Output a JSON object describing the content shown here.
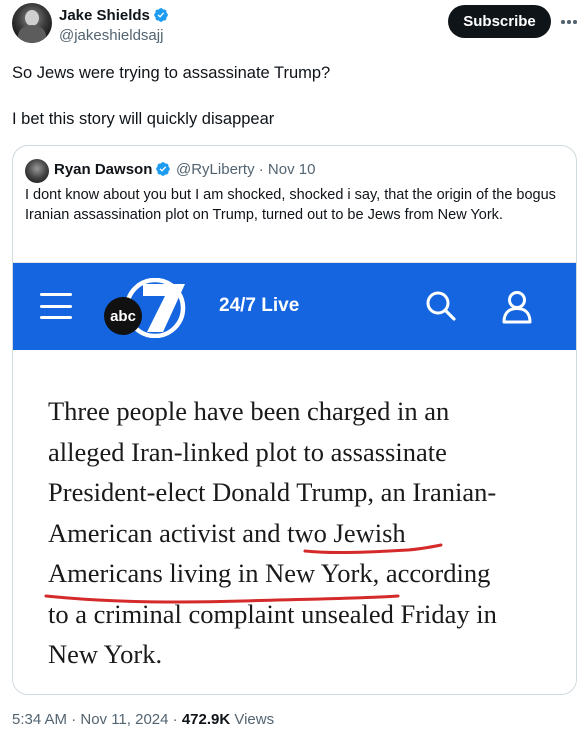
{
  "author": {
    "name": "Jake Shields",
    "handle": "@jakeshieldsajj",
    "subscribe_label": "Subscribe"
  },
  "tweet": {
    "line1": "So Jews were trying to assassinate Trump?",
    "line2": "I bet this story will quickly disappear"
  },
  "quote": {
    "name": "Ryan Dawson",
    "meta": "@RyLiberty · Nov 10",
    "text": "I dont know about you but I am shocked, shocked i say, that the origin of the bogus Iranian assassination plot on Trump, turned out to be Jews from New York.",
    "image": {
      "bar": {
        "live_label": "24/7 Live",
        "logo_text": "abc",
        "brand_color": "#1565e0"
      },
      "headline_lines": [
        "Three people have been charged in an",
        "alleged Iran-linked plot to assassinate",
        "President-elect Donald Trump, an Iranian-",
        "American activist and two Jewish",
        "Americans living in New York, according",
        "to a criminal complaint unsealed Friday in",
        "New York."
      ],
      "annotation_color": "#d42a2a"
    }
  },
  "footer": {
    "time": "5:34 AM · Nov 11, 2024 · ",
    "views_count": "472.9K",
    "views_label": " Views"
  },
  "icons": {
    "verified": "verified-badge-icon",
    "more": "more-options-icon",
    "menu": "hamburger-menu-icon",
    "search": "search-icon",
    "account": "account-icon"
  },
  "colors": {
    "text": "#0f1419",
    "secondary": "#536471",
    "verified": "#1d9bf0",
    "border": "#cfd9de"
  }
}
